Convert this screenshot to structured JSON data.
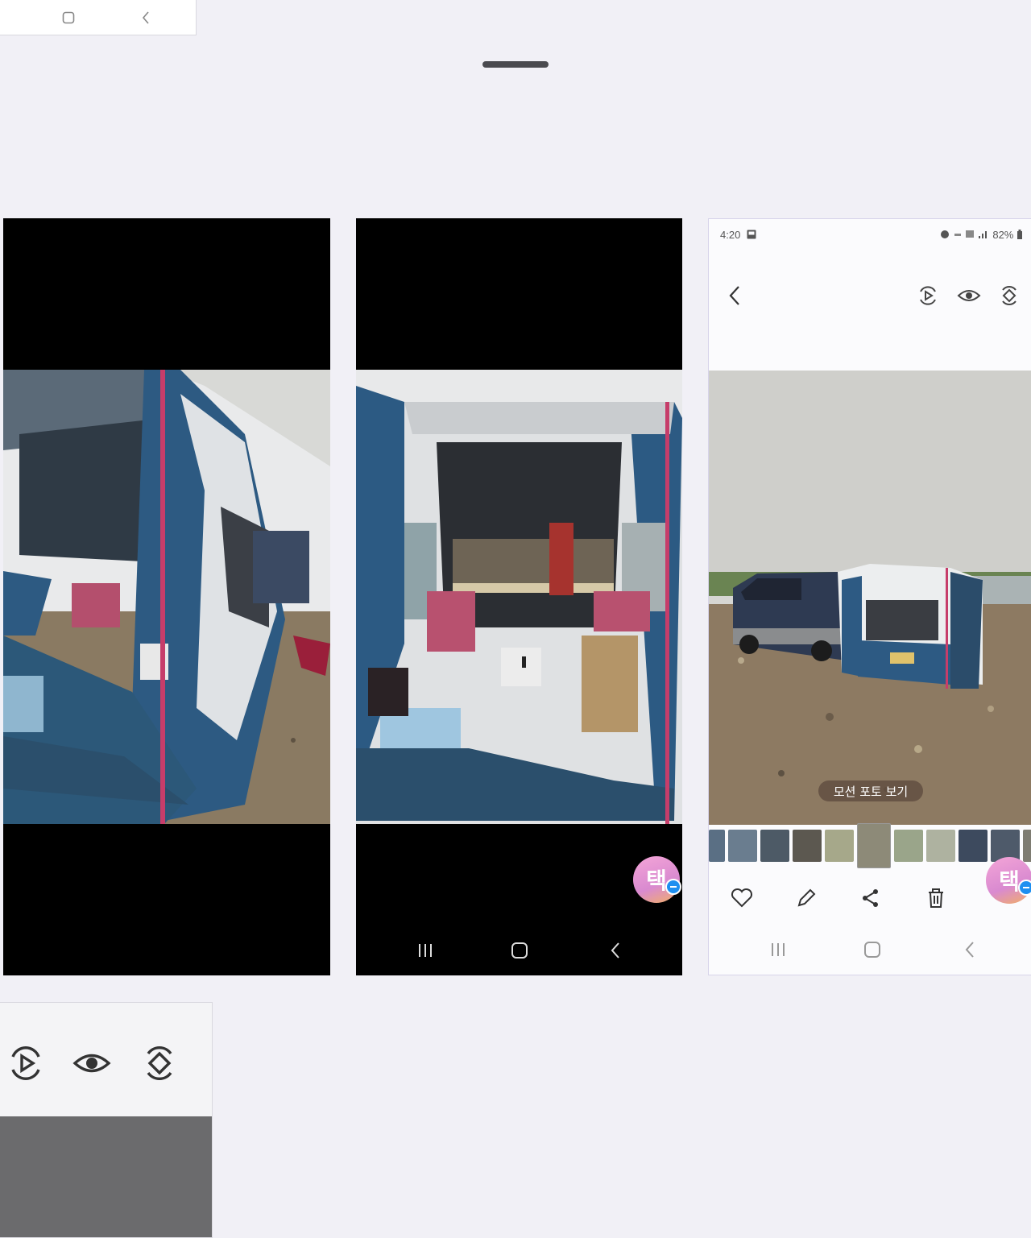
{
  "top_nav": {
    "icons": [
      "home-square-icon",
      "back-chevron-icon"
    ]
  },
  "screenshots": [
    {
      "id": "card-1",
      "photo": "tent-interior-left-view"
    },
    {
      "id": "card-2",
      "photo": "tent-interior-center-view",
      "tag_avatar": "택",
      "nav_icons": [
        "recents-icon",
        "home-icon",
        "back-icon"
      ]
    },
    {
      "id": "card-3",
      "status_time": "4:20",
      "status_battery": "82%",
      "photo": "van-with-tent-on-riverbank",
      "motion_photo_label": "모션 포토 보기",
      "tag_avatar": "택",
      "actions": [
        "heart-icon",
        "pencil-icon",
        "share-icon",
        "trash-icon"
      ],
      "nav_icons": [
        "recents-icon",
        "home-icon",
        "back-icon"
      ]
    }
  ],
  "bottom_left_toolbar": {
    "icons": [
      "motion-play-icon",
      "eye-icon",
      "rotate-icon"
    ]
  },
  "colors": {
    "background": "#f1f0f6",
    "accent_blue": "#1f8ff0"
  }
}
